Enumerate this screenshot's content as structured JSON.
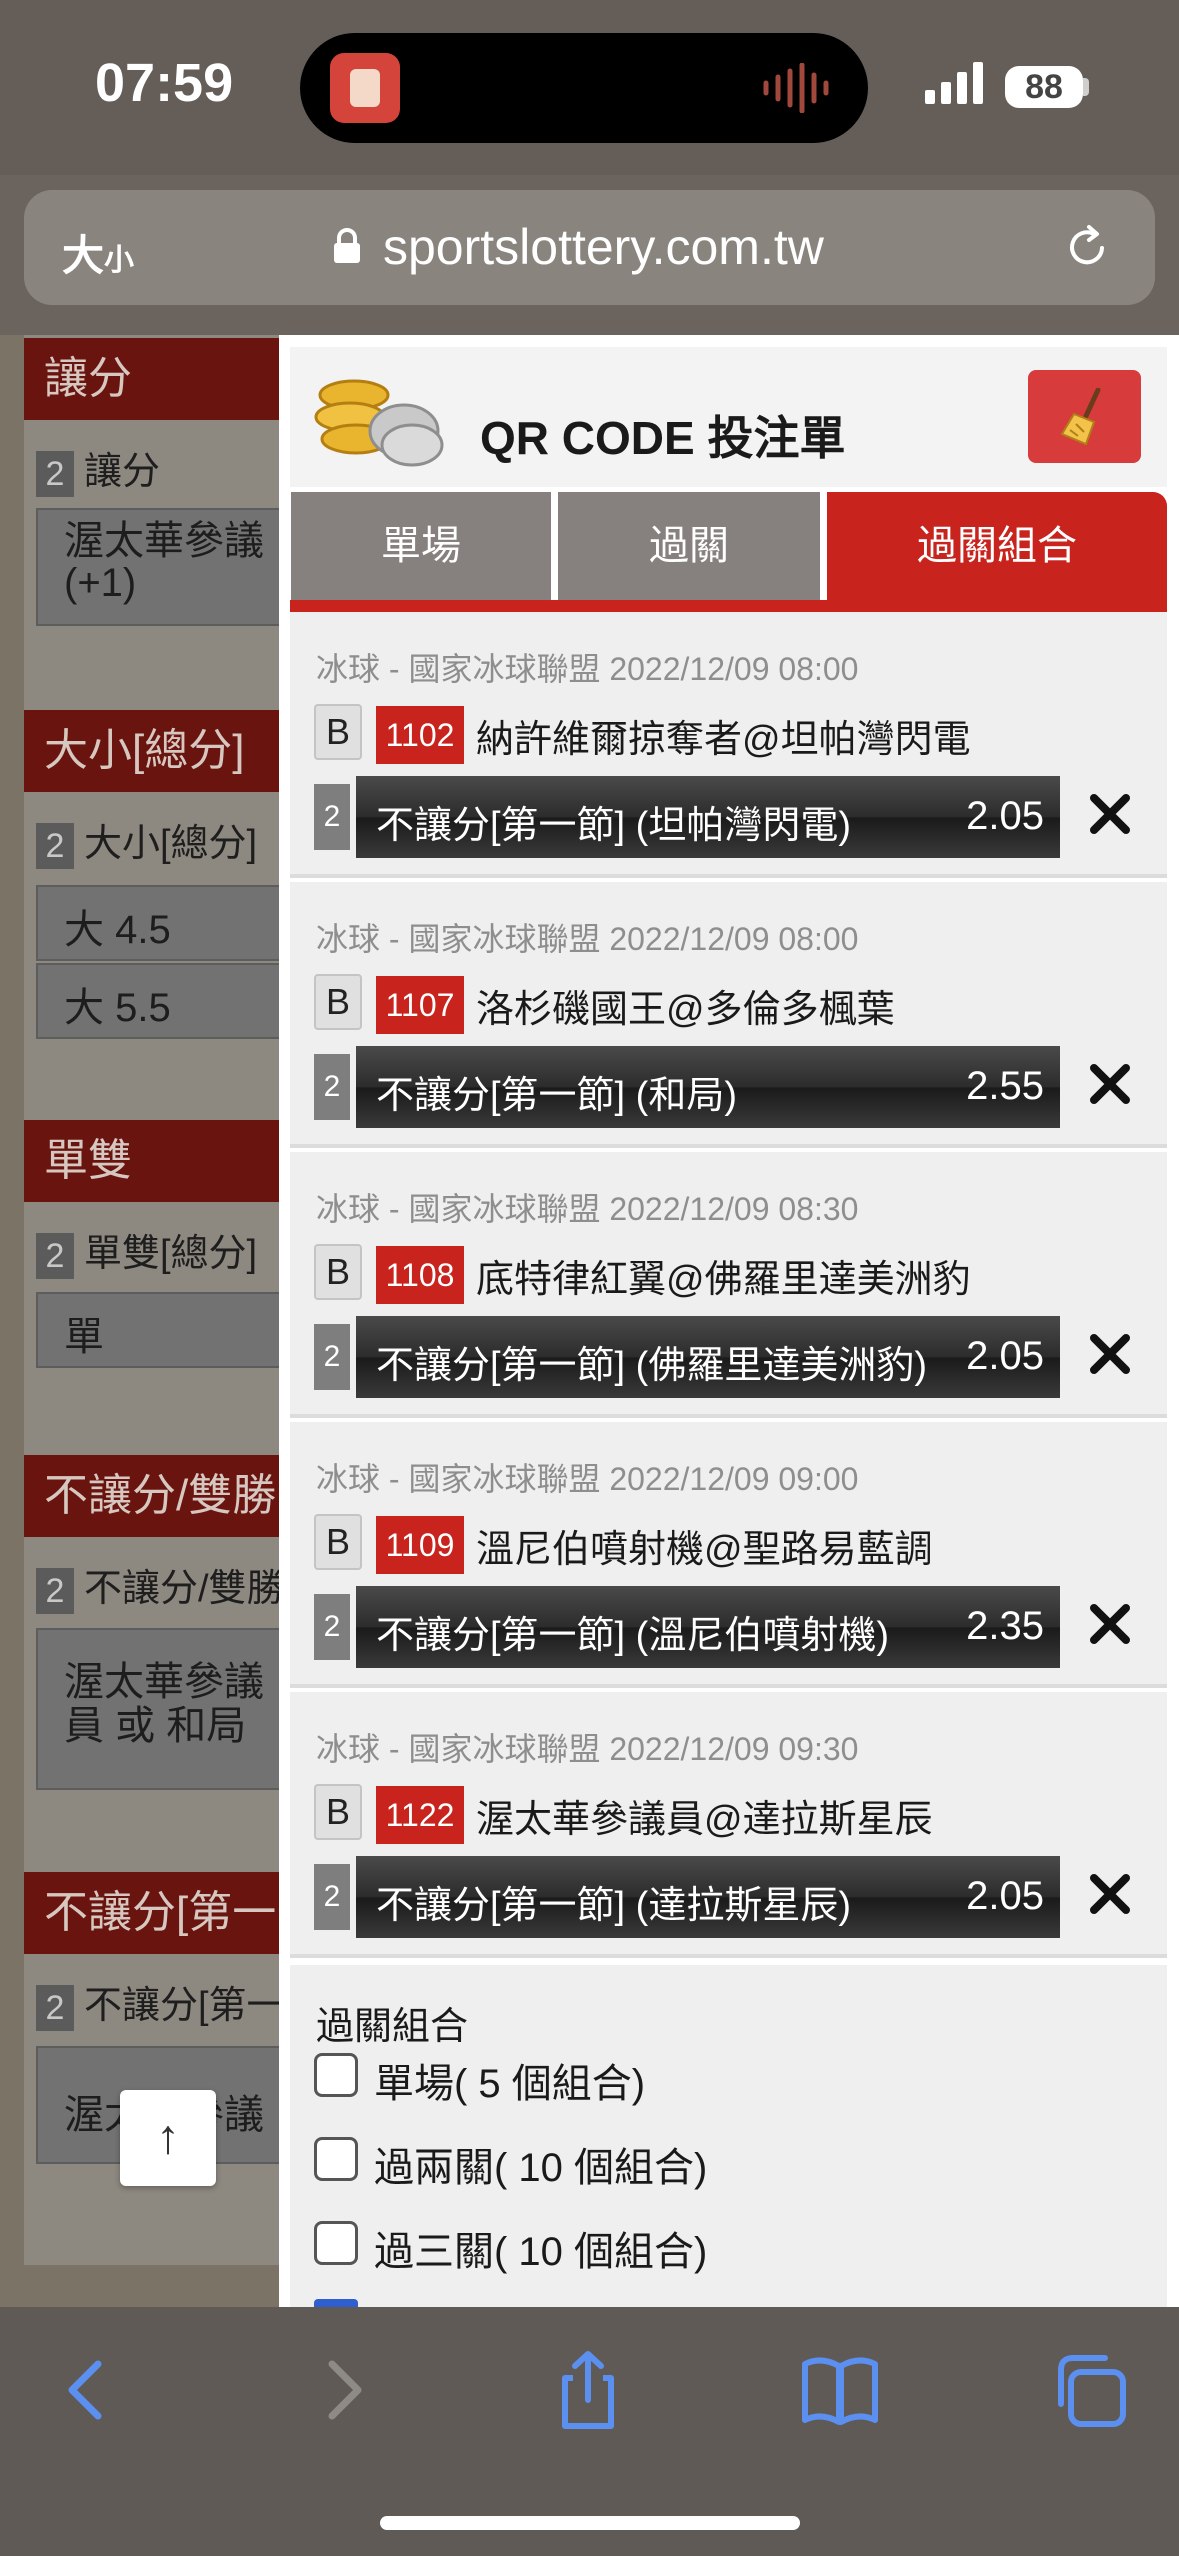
{
  "status": {
    "time": "07:59",
    "battery": "88"
  },
  "browser": {
    "text_size_label": "大",
    "text_size_small": "小",
    "url": "sportslottery.com.tw"
  },
  "background_page": {
    "sections": [
      {
        "header": "讓分",
        "sub_num": "2",
        "sub_label": "讓分",
        "options": [
          "渥太華參議",
          "(+1)"
        ]
      },
      {
        "header": "大小[總分]",
        "sub_num": "2",
        "sub_label": "大小[總分]",
        "options": [
          "大 4.5",
          "大 5.5"
        ]
      },
      {
        "header": "單雙",
        "sub_num": "2",
        "sub_label": "單雙[總分]",
        "options": [
          "單"
        ]
      },
      {
        "header": "不讓分/雙勝",
        "sub_num": "2",
        "sub_label": "不讓分/雙勝",
        "options": [
          "渥太華參議",
          "員 或 和局"
        ]
      },
      {
        "header": "不讓分[第一",
        "sub_num": "2",
        "sub_label": "不讓分[第一",
        "options": [
          "渥太華參議"
        ]
      }
    ],
    "scroll_top": "↑"
  },
  "panel": {
    "title": "QR CODE 投注單",
    "tabs": [
      {
        "label": "單場",
        "active": false
      },
      {
        "label": "過關",
        "active": false
      },
      {
        "label": "過關組合",
        "active": true
      }
    ],
    "bets": [
      {
        "league": "冰球 - 國家冰球聯盟 2022/12/09 08:00",
        "type": "B",
        "code": "1102",
        "match": "納許維爾掠奪者@坦帕灣閃電",
        "num": "2",
        "pick": "不讓分[第一節] (坦帕灣閃電)",
        "odds": "2.05"
      },
      {
        "league": "冰球 - 國家冰球聯盟 2022/12/09 08:00",
        "type": "B",
        "code": "1107",
        "match": "洛杉磯國王@多倫多楓葉",
        "num": "2",
        "pick": "不讓分[第一節] (和局)",
        "odds": "2.55"
      },
      {
        "league": "冰球 - 國家冰球聯盟 2022/12/09 08:30",
        "type": "B",
        "code": "1108",
        "match": "底特律紅翼@佛羅里達美洲豹",
        "num": "2",
        "pick": "不讓分[第一節] (佛羅里達美洲豹)",
        "odds": "2.05"
      },
      {
        "league": "冰球 - 國家冰球聯盟 2022/12/09 09:00",
        "type": "B",
        "code": "1109",
        "match": "溫尼伯噴射機@聖路易藍調",
        "num": "2",
        "pick": "不讓分[第一節] (溫尼伯噴射機)",
        "odds": "2.35"
      },
      {
        "league": "冰球 - 國家冰球聯盟 2022/12/09 09:30",
        "type": "B",
        "code": "1122",
        "match": "渥太華參議員@達拉斯星辰",
        "num": "2",
        "pick": "不讓分[第一節] (達拉斯星辰)",
        "odds": "2.05"
      }
    ],
    "combo": {
      "title": "過關組合",
      "options": [
        {
          "label": "單場( 5 個組合)",
          "checked": false
        },
        {
          "label": "過兩關( 10 個組合)",
          "checked": false
        },
        {
          "label": "過三關( 10 個組合)",
          "checked": false
        }
      ]
    }
  },
  "toolbar": {
    "icons": [
      "back-icon",
      "forward-icon",
      "share-icon",
      "bookmarks-icon",
      "tabs-icon"
    ]
  },
  "colors": {
    "accent_red": "#c8231d",
    "toolbar_icon": "#5b8ff0"
  }
}
